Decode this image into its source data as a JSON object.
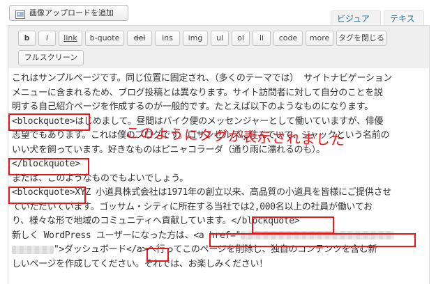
{
  "media_button": {
    "label": "画像アップロードを追加",
    "icon": "media-upload-icon"
  },
  "tabs": {
    "visual": "ビジュアル",
    "text": "テキスト"
  },
  "toolbar": {
    "row1": [
      "b",
      "i",
      "link",
      "b-quote",
      "del",
      "ins",
      "img",
      "ul",
      "ol",
      "li",
      "code",
      "more",
      "タグを閉じる"
    ],
    "row2": [
      "フルスクリーン"
    ]
  },
  "content": {
    "l1": "これはサンプルページです。同じ位置に固定され、（多くのテーマでは） サイトナビゲーション",
    "l2": "メニューに含まれるため、ブログ投稿とは異なります。サイト訪問者に対して自分のことを説",
    "l3": "明する自己紹介ページを作成するのが一般的です。たとえば以下のようなものになります。",
    "l4_tag": "<blockquote>",
    "l4_rest": "はじめまして。昼間はバイク便のメッセンジャーとして働いていますが、俳優",
    "l5": "志望でもあります。これは僕のブログです。ロサンゼルスに住んでいて、ジャックという名前の",
    "l6": "いい犬を飼っています。好きなものはピニャコラーダ（通り雨に濡れるのも）。",
    "l7_tag": "</blockquote>",
    "l8": "または、このようなものでもよいでしょう。",
    "l9_tag": "<blockquote>",
    "l9_rest": "XYZ 小道具株式会社は1971年の創立以来、高品質の小道具を皆様にご提供させ",
    "l10": "ていただいています。ゴッサム・シティに所在する当社では2,000名以上の社員が働いてお",
    "l11_a": "り、様々な形で地域のコミュニティへ貢献しています。",
    "l11_tag": "</blockquote>",
    "l12_a": "新しく WordPress ユーザーになった方は、",
    "l12_tag": "<a href=\"",
    "l13_b": "\">ダッシュボード",
    "l13_tag": "</a>",
    "l13_c": "へ行ってこのページを削除し、独自のコンテンツを含む新",
    "l14": "しいページを作成してください。それでは、お楽しみください！"
  },
  "annotation": "このようにタグが表示されました",
  "colors": {
    "highlight": "#e8151c",
    "link": "#21759b"
  }
}
